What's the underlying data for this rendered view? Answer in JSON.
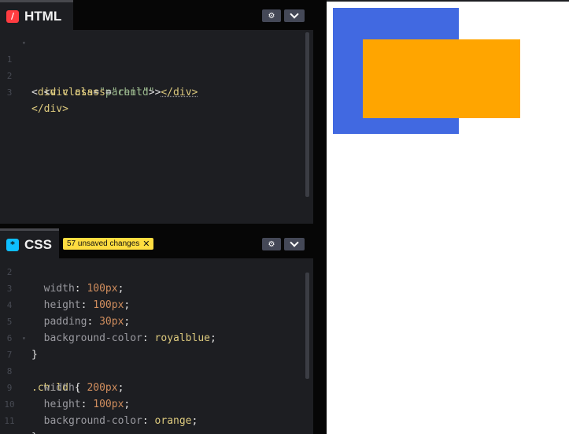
{
  "html_panel": {
    "tab_label": "HTML",
    "icon_glyph": "/",
    "icon_color": "#ff3c41",
    "lines": [
      {
        "num": "1",
        "indent": "",
        "open": "<",
        "tag": "div",
        "attr": " class",
        "eq": "=",
        "str": "\"parent\"",
        "close": ">",
        "end": ""
      },
      {
        "num": "2",
        "indent": "  ",
        "open": "<",
        "tag": "div",
        "attr": " class",
        "eq": "=",
        "str": "\"child\"",
        "close": ">",
        "end": "</div>"
      },
      {
        "num": "3",
        "indent": "",
        "text": "</div>"
      }
    ]
  },
  "css_panel": {
    "tab_label": "CSS",
    "icon_glyph": "*",
    "icon_color": "#0ebeff",
    "badge_text": "57 unsaved changes",
    "badge_close": "✕",
    "lines": [
      {
        "num": "2",
        "prop": "width",
        "val": "100px",
        "kind": "num"
      },
      {
        "num": "3",
        "prop": "height",
        "val": "100px",
        "kind": "num"
      },
      {
        "num": "4",
        "prop": "padding",
        "val": "30px",
        "kind": "num"
      },
      {
        "num": "5",
        "prop": "background-color",
        "val": "royalblue",
        "kind": "kw"
      },
      {
        "num": "6",
        "text": "}"
      },
      {
        "num": "7",
        "sel": ".child",
        "brace": " {"
      },
      {
        "num": "8",
        "prop": "width",
        "val": "200px",
        "kind": "num"
      },
      {
        "num": "9",
        "prop": "height",
        "val": "100px",
        "kind": "num"
      },
      {
        "num": "10",
        "prop": "background-color",
        "val": "orange",
        "kind": "kw"
      },
      {
        "num": "11",
        "text": "}"
      }
    ]
  },
  "header_buttons": {
    "settings_glyph": "⚙",
    "collapse_glyph": "⌄"
  },
  "preview": {
    "parent_color": "#4169e1",
    "child_color": "#ffa500"
  }
}
